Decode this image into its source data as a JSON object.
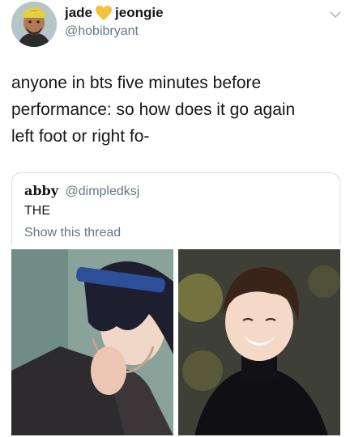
{
  "tweet": {
    "display_name_first": "jade",
    "display_name_second": "jeongie",
    "emoji_icon": "yellow-heart-icon",
    "handle": "@hobibryant",
    "text_lines": [
      "anyone in bts five minutes before",
      "performance: so how does it go again",
      "left foot or right fo-"
    ]
  },
  "quoted_tweet": {
    "name": "abby",
    "handle": "@dimpledksj",
    "text": "THE",
    "show_thread": "Show this thread"
  },
  "colors": {
    "text_primary": "#14171a",
    "text_secondary": "#657786",
    "border": "#d7dde2",
    "heart": "#f5c13b"
  }
}
